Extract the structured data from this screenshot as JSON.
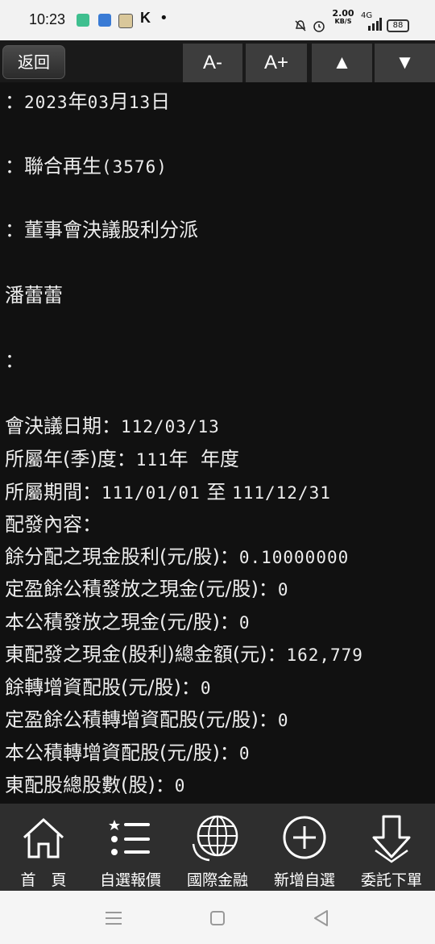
{
  "status_bar": {
    "time": "10:23",
    "k_icon": "K",
    "dot": "•",
    "speed_value": "2.00",
    "speed_unit": "KB/S",
    "network": "4G",
    "battery": "88"
  },
  "toolbar": {
    "back_label": "返回",
    "font_decrease": "A-",
    "font_increase": "A+",
    "up_label": "▲",
    "down_label": "▼"
  },
  "article": {
    "lines": [
      {
        "label": "：",
        "value": "2023"
      },
      {
        "label": "：聯合再生",
        "value": "(3576)"
      },
      {
        "label": "：董事會決議股利分派",
        "value": ""
      },
      {
        "label": "潘蕾蕾",
        "value": ""
      },
      {
        "label": "：",
        "value": ""
      },
      {
        "label": "會決議日期：",
        "value": "112/03/13"
      },
      {
        "label": "所屬年(季)度：",
        "value": "111"
      },
      {
        "label": "所屬期間：",
        "value": "111/01/01"
      },
      {
        "label": "配發內容：",
        "value": ""
      },
      {
        "label": "餘分配之現金股利(元/股)：",
        "value": "0.10000000"
      },
      {
        "label": "定盈餘公積發放之現金(元/股)：",
        "value": "0"
      },
      {
        "label": "本公積發放之現金(元/股)：",
        "value": "0"
      },
      {
        "label": "東配發之現金(股利)總金額(元)：",
        "value": "162,779"
      },
      {
        "label": "餘轉增資配股(元/股)：",
        "value": "0"
      },
      {
        "label": "定盈餘公積轉增資配股(元/股)：",
        "value": "0"
      },
      {
        "label": "本公積轉增資配股(元/股)：",
        "value": "0"
      },
      {
        "label": "東配股總股數(股)：",
        "value": "0"
      }
    ],
    "date_line": {
      "label": "：",
      "year": "2023",
      "y": "年",
      "month": "03",
      "m": "月",
      "day": "13",
      "d": "日"
    },
    "company": {
      "label": "：聯合再生",
      "code": "(3576)"
    },
    "subject": "：董事會決議股利分派",
    "author": "潘蕾蕾",
    "colon_only": "：",
    "meeting_date": {
      "label": "會決議日期：",
      "value": "112/03/13"
    },
    "fiscal_year": {
      "label": "所屬年(季)度：",
      "year": "111",
      "y": "年",
      "suffix": "年度"
    },
    "period": {
      "label": "所屬期間：",
      "from": "111/01/01",
      "to_word": "至",
      "to": "111/12/31"
    },
    "distribution_heading": "配發內容：",
    "cash_dividend": {
      "label": "餘分配之現金股利(元/股)：",
      "value": "0.10000000"
    },
    "reserve_cash": {
      "label": "定盈餘公積發放之現金(元/股)：",
      "value": "0"
    },
    "capital_reserve_cash": {
      "label": "本公積發放之現金(元/股)：",
      "value": "0"
    },
    "total_cash": {
      "label": "東配發之現金(股利)總金額(元)：",
      "value": "162,779"
    },
    "stock_dividend": {
      "label": "餘轉增資配股(元/股)：",
      "value": "0"
    },
    "reserve_stock": {
      "label": "定盈餘公積轉增資配股(元/股)：",
      "value": "0"
    },
    "capital_reserve_stock": {
      "label": "本公積轉增資配股(元/股)：",
      "value": "0"
    },
    "total_shares": {
      "label": "東配股總股數(股)：",
      "value": "0"
    }
  },
  "bottom_nav": {
    "items": [
      {
        "label": "首　頁",
        "icon": "home-icon"
      },
      {
        "label": "自選報價",
        "icon": "list-icon"
      },
      {
        "label": "國際金融",
        "icon": "globe-icon"
      },
      {
        "label": "新增自選",
        "icon": "add-icon"
      },
      {
        "label": "委託下單",
        "icon": "down-arrow-icon"
      }
    ]
  },
  "colors": {
    "background": "#111111",
    "text": "#e6e6e6",
    "toolbar_button": "#3d3d3d",
    "bottom_nav": "#2e2e2e"
  }
}
